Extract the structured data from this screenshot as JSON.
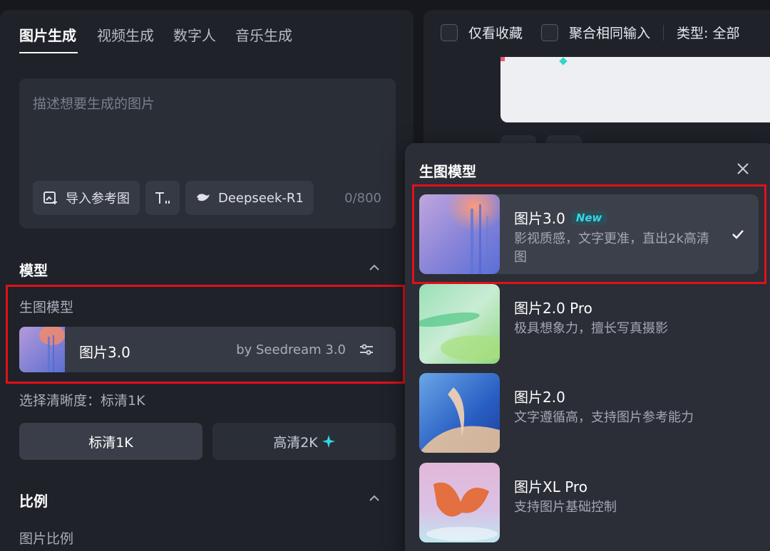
{
  "tabs": [
    {
      "label": "图片生成"
    },
    {
      "label": "视频生成"
    },
    {
      "label": "数字人"
    },
    {
      "label": "音乐生成"
    }
  ],
  "prompt": {
    "placeholder": "描述想要生成的图片",
    "import_ref_label": "导入参考图",
    "deepseek_label": "Deepseek-R1",
    "counter": "0/800"
  },
  "model_section": {
    "title": "模型",
    "sub_label": "生图模型",
    "current_model": "图片3.0",
    "current_by": "by Seedream 3.0"
  },
  "resolution": {
    "label": "选择清晰度：标清1K",
    "options": [
      {
        "label": "标清1K",
        "selected": true
      },
      {
        "label": "高清2K",
        "selected": false
      }
    ]
  },
  "ratio_section": {
    "title": "比例",
    "sub_label": "图片比例"
  },
  "filters": {
    "favorites_label": "仅看收藏",
    "merge_label": "聚合相同输入",
    "type_label": "类型: 全部"
  },
  "popup": {
    "title": "生图模型",
    "options": [
      {
        "name": "图片3.0",
        "badge": "New",
        "desc": "影视质感，文字更准，直出2k高清图",
        "selected": true
      },
      {
        "name": "图片2.0 Pro",
        "desc": "极具想象力，擅长写真摄影",
        "selected": false
      },
      {
        "name": "图片2.0",
        "desc": "文字遵循高，支持图片参考能力",
        "selected": false
      },
      {
        "name": "图片XL Pro",
        "desc": "支持图片基础控制",
        "selected": false
      }
    ]
  },
  "colors": {
    "highlight_border": "#e2101a",
    "new_badge": "#34d7e6",
    "panel_bg": "#1f2229",
    "popup_bg": "#2b2e36"
  }
}
